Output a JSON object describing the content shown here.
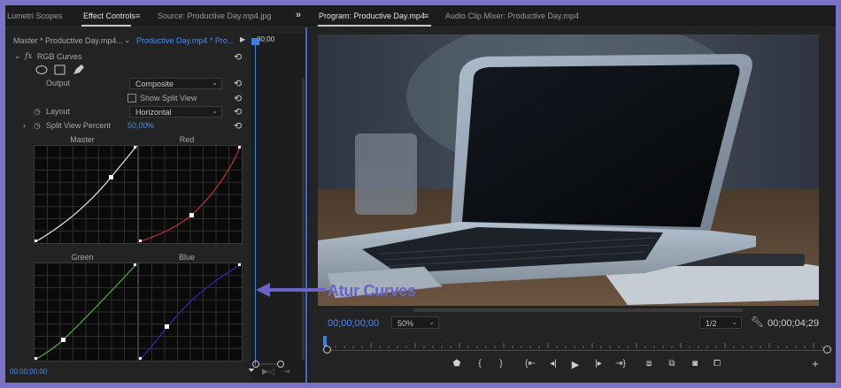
{
  "left_tabs": {
    "lumetri": "Lumetri Scopes",
    "effect_controls": "Effect Controls",
    "source": "Source: Productive Day.mp4.jpg"
  },
  "source_row": {
    "master": "Master * Productive Day.mp4...",
    "clip": "Productive Day.mp4 * Pro...",
    "timecode": "00;00"
  },
  "effect": {
    "fx": "fx",
    "name": "RGB Curves",
    "output_label": "Output",
    "output_value": "Composite",
    "split_view_label": "Show Split View",
    "layout_label": "Layout",
    "layout_value": "Horizontal",
    "split_percent_label": "Split View Percent",
    "split_percent_value": "50,00",
    "split_percent_unit": "%"
  },
  "graphs": {
    "master": "Master",
    "red": "Red",
    "green": "Green",
    "blue": "Blue"
  },
  "left_bottom_time": "00;00;00;00",
  "right_tabs": {
    "program": "Program: Productive Day.mp4",
    "audio_mixer": "Audio Clip Mixer: Productive Day.mp4"
  },
  "monitor": {
    "current_time": "00;00;00;00",
    "zoom": "50%",
    "resolution": "1/2",
    "duration": "00;00;04;29"
  },
  "annotation": "Atur Curves",
  "colors": {
    "accent_blue": "#4a8cf0",
    "annotation": "#6a63c7",
    "master_curve": "#e8e8e8",
    "red_curve": "#c0302a",
    "green_curve": "#4fae3e",
    "blue_curve": "#2a2ab8"
  }
}
